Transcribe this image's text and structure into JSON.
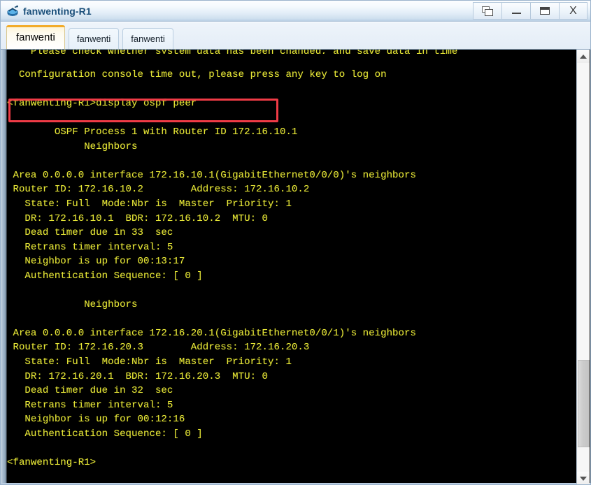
{
  "window": {
    "title": "fanwenting-R1",
    "icon": "router-device-icon",
    "buttons": [
      {
        "name": "restore-button",
        "label": "",
        "icon": "restore-windows-icon"
      },
      {
        "name": "minimize-button",
        "label": "",
        "icon": "minimize-icon"
      },
      {
        "name": "maximize-button",
        "label": "",
        "icon": "maximize-icon"
      },
      {
        "name": "close-button",
        "label": "X",
        "icon": "close-icon"
      }
    ]
  },
  "tabs": [
    {
      "label": "fanwenti",
      "active": true
    },
    {
      "label": "fanwenti",
      "active": false
    },
    {
      "label": "fanwenti",
      "active": false
    }
  ],
  "terminal": {
    "foreground_color": "#e8e837",
    "background_color": "#000000",
    "highlight_color": "#ef3b46",
    "prompt": "<fanwenting-R1>",
    "command": "display ospf peer",
    "lines": [
      "    Please check whether system data has been changed, and save data in time",
      "",
      "  Configuration console time out, please press any key to log on",
      "",
      "<fanwenting-R1>display ospf peer",
      "",
      "        OSPF Process 1 with Router ID 172.16.10.1",
      "             Neighbors",
      "",
      " Area 0.0.0.0 interface 172.16.10.1(GigabitEthernet0/0/0)'s neighbors",
      " Router ID: 172.16.10.2        Address: 172.16.10.2",
      "   State: Full  Mode:Nbr is  Master  Priority: 1",
      "   DR: 172.16.10.1  BDR: 172.16.10.2  MTU: 0",
      "   Dead timer due in 33  sec",
      "   Retrans timer interval: 5",
      "   Neighbor is up for 00:13:17",
      "   Authentication Sequence: [ 0 ]",
      "",
      "             Neighbors",
      "",
      " Area 0.0.0.0 interface 172.16.20.1(GigabitEthernet0/0/1)'s neighbors",
      " Router ID: 172.16.20.3        Address: 172.16.20.3",
      "   State: Full  Mode:Nbr is  Master  Priority: 1",
      "   DR: 172.16.20.1  BDR: 172.16.20.3  MTU: 0",
      "   Dead timer due in 32  sec",
      "   Retrans timer interval: 5",
      "   Neighbor is up for 00:12:16",
      "   Authentication Sequence: [ 0 ]",
      "",
      "<fanwenting-R1>"
    ]
  },
  "scrollbar": {
    "up_arrow": "scroll-up-icon",
    "down_arrow": "scroll-down-icon"
  }
}
